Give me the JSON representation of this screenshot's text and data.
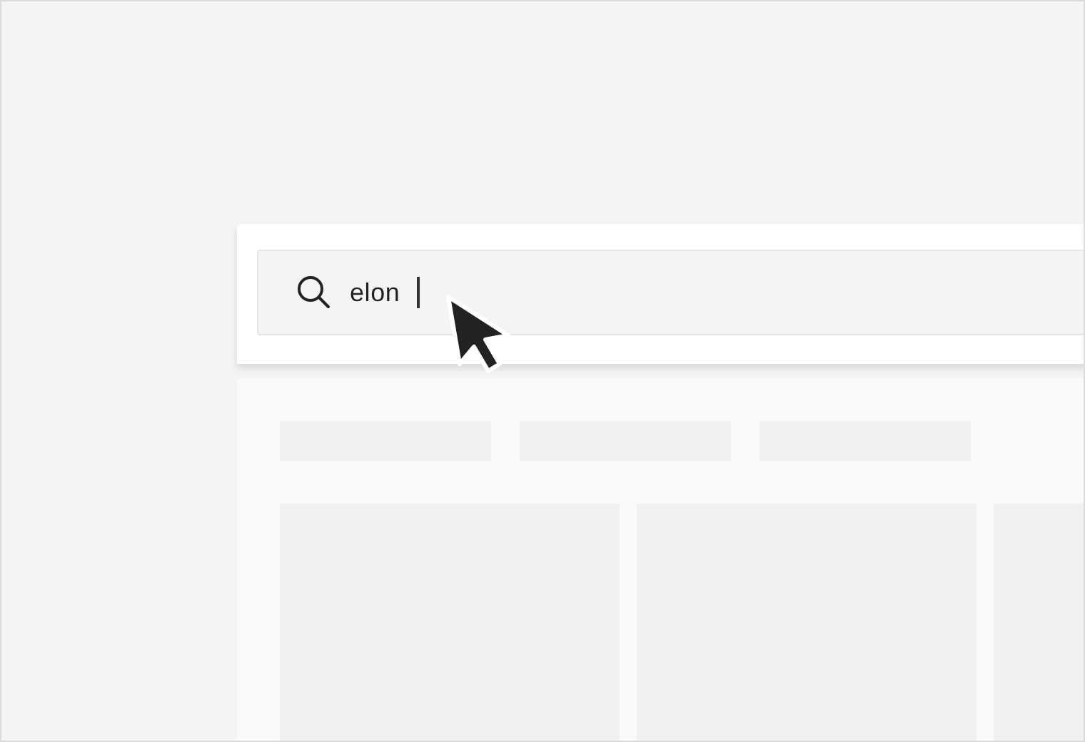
{
  "search": {
    "value": "elon"
  }
}
